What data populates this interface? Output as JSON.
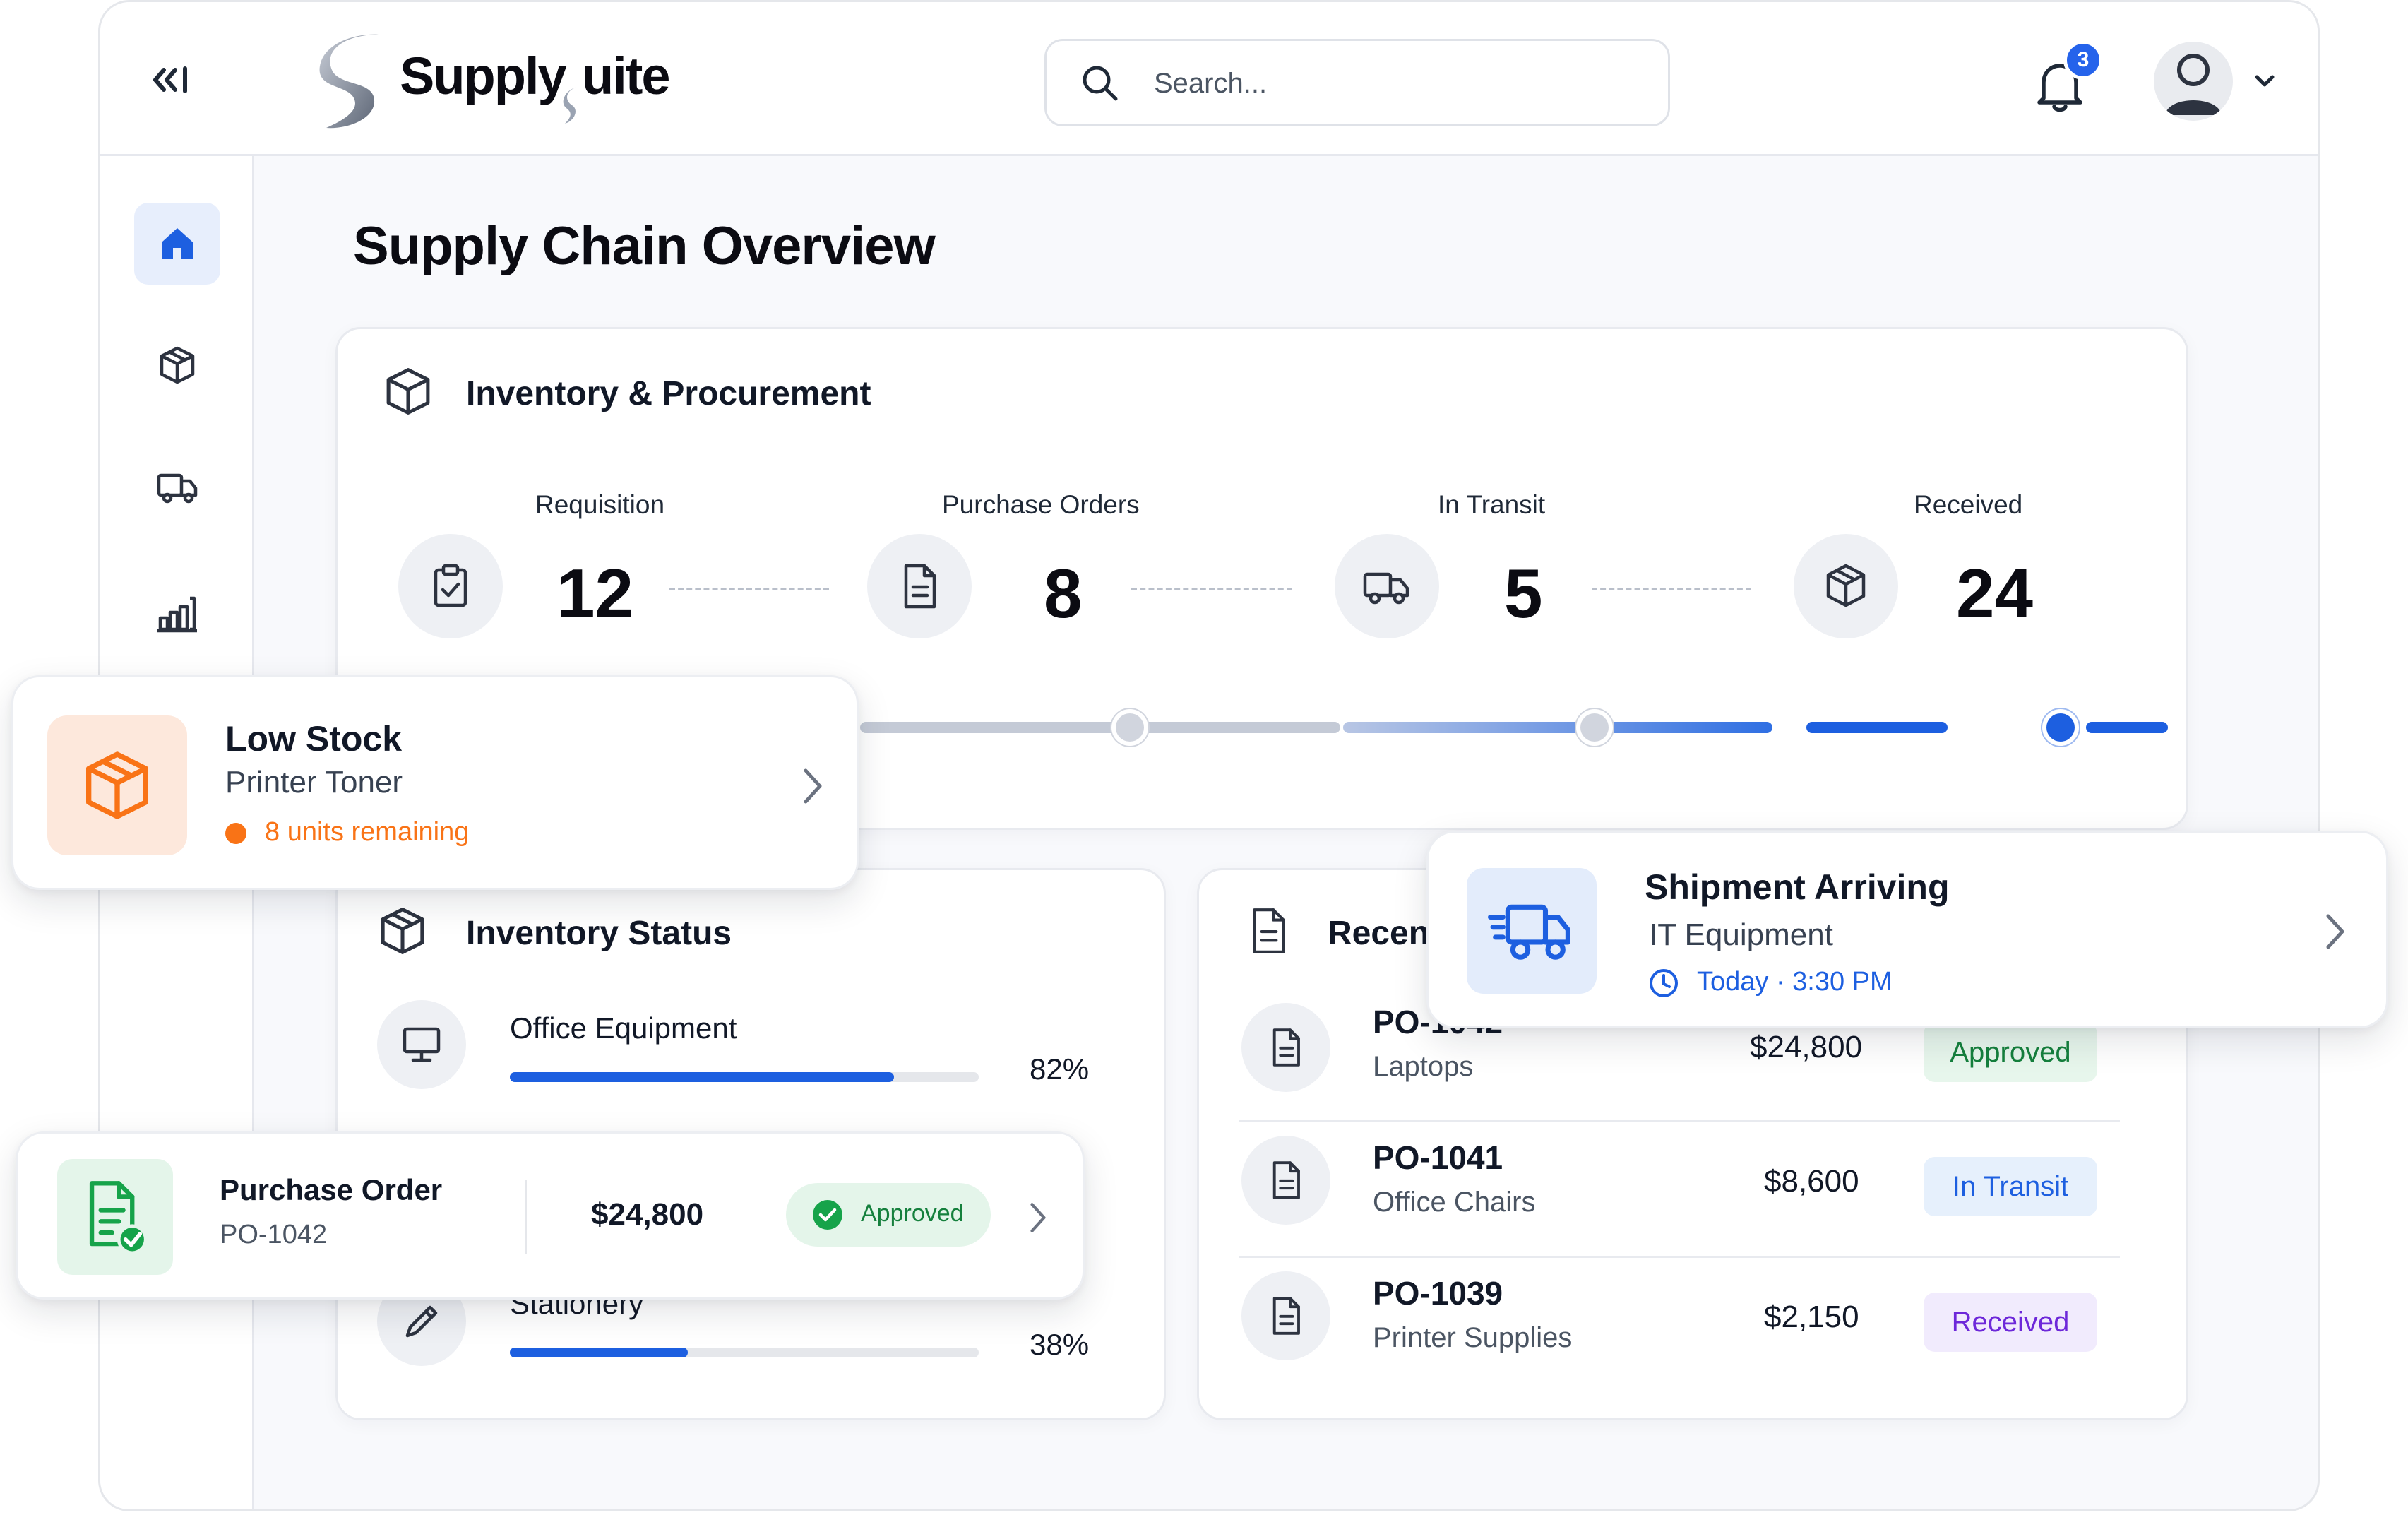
{
  "brand": {
    "name_part1": "Supply",
    "name_part2": "uite"
  },
  "header": {
    "search_placeholder": "Search...",
    "notification_count": "3"
  },
  "sidebar": {
    "items": [
      {
        "icon": "home-icon",
        "active": true
      },
      {
        "icon": "package-icon",
        "active": false
      },
      {
        "icon": "truck-icon",
        "active": false
      },
      {
        "icon": "chart-icon",
        "active": false
      }
    ]
  },
  "page": {
    "title": "Supply Chain Overview"
  },
  "procurement": {
    "title": "Inventory & Procurement",
    "stages": [
      {
        "label": "Requisition",
        "value": "12",
        "icon": "clipboard-check-icon"
      },
      {
        "label": "Purchase Orders",
        "value": "8",
        "icon": "document-icon"
      },
      {
        "label": "In Transit",
        "value": "5",
        "icon": "truck-icon"
      },
      {
        "label": "Received",
        "value": "24",
        "icon": "package-icon"
      }
    ],
    "current_stage_index": 3
  },
  "inventory_status": {
    "title": "Inventory Status",
    "items": [
      {
        "label": "Office Equipment",
        "percent_text": "82%",
        "percent": 82,
        "icon": "monitor-icon"
      },
      {
        "label": "Stationery",
        "percent_text": "38%",
        "percent": 38,
        "icon": "pencil-icon"
      }
    ]
  },
  "recent_orders": {
    "title": "Recent",
    "rows": [
      {
        "id": "PO-1042",
        "item": "Laptops",
        "amount": "$24,800",
        "status": "Approved"
      },
      {
        "id": "PO-1041",
        "item": "Office Chairs",
        "amount": "$8,600",
        "status": "In Transit"
      },
      {
        "id": "PO-1039",
        "item": "Printer Supplies",
        "amount": "$2,150",
        "status": "Received"
      }
    ]
  },
  "notifications": {
    "low_stock": {
      "title": "Low Stock",
      "item": "Printer Toner",
      "detail": "8 units remaining"
    },
    "shipment": {
      "title": "Shipment Arriving",
      "item": "IT Equipment",
      "time": "Today · 3:30 PM"
    },
    "purchase_order": {
      "title": "Purchase Order",
      "id": "PO-1042",
      "amount": "$24,800",
      "status": "Approved"
    }
  },
  "colors": {
    "accent": "#1d5fe0",
    "approved_bg": "#e7f6ec",
    "approved_text": "#15803d",
    "in_transit_bg": "#e6f0fc",
    "in_transit_text": "#1d5fe0",
    "received_bg": "#f1ebfd",
    "received_text": "#6d28d9",
    "warning": "#f97316"
  }
}
